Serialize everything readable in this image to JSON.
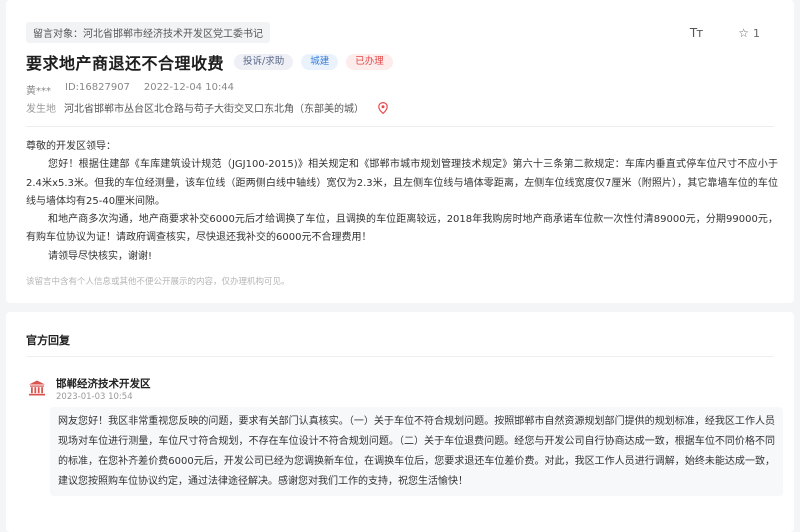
{
  "message": {
    "target_label": "留言对象：河北省邯郸市经济技术开发区党工委书记",
    "title": "要求地产商退还不合理收费",
    "badges": {
      "category": "投诉/求助",
      "department": "城建",
      "status": "已办理"
    },
    "tools": {
      "font_icon": "Tт",
      "likes": "1"
    },
    "author": "黄***",
    "id_label": "ID:16827907",
    "date": "2022-12-04 10:44",
    "location_label": "发生地",
    "location_value": "河北省邯郸市丛台区北仓路与苟子大街交叉口东北角（东部美的城）",
    "greeting": "尊敬的开发区领导：",
    "paragraphs": [
      "您好！根据住建部《车库建筑设计规范（JGJ100-2015)》相关规定和《邯郸市城市规划管理技术规定》第六十三条第二款规定：车库内垂直式停车位尺寸不应小于2.4米x5.3米。但我的车位经测量，该车位线（距两侧白线中轴线）宽仅为2.3米，且左侧车位线与墙体零距离，左侧车位线宽度仅7厘米（附照片），其它靠墙车位的车位线与墙体均有25-40厘米间隙。",
      "和地产商多次沟通，地产商要求补交6000元后才给调换了车位，且调换的车位距离较远，2018年我购房时地产商承诺车位款一次性付清89000元，分期99000元，有购车位协议为证！请政府调查核实，尽快退还我补交的6000元不合理费用！",
      "请领导尽快核实，谢谢!"
    ],
    "privacy_notice": "该留言中含有个人信息或其他不便公开展示的内容，仅办理机构可见。"
  },
  "reply": {
    "section_title": "官方回复",
    "org_name": "邯郸经济技术开发区",
    "date": "2023-01-03 10:54",
    "content": "网友您好！我区非常重视您反映的问题，要求有关部门认真核实。（一）关于车位不符合规划问题。按照邯郸市自然资源规划部门提供的规划标准，经我区工作人员现场对车位进行测量，车位尺寸符合规划，不存在车位设计不符合规划问题。（二）关于车位退费问题。经您与开发公司自行协商达成一致，根据车位不同价格不同的标准，在您补齐差价费6000元后，开发公司已经为您调换新车位，在调换车位后，您要求退还车位差价费。对此，我区工作人员进行调解，始终未能达成一致，建议您按照购车位协议约定，通过法律途径解决。感谢您对我们工作的支持，祝您生活愉快！"
  },
  "colors": {
    "status_red": "#e34a4a",
    "department_blue": "#3b7ed8",
    "pin_red": "#e84a4a",
    "org_icon_red": "#d9534f"
  },
  "icons": {
    "pin": "location-pin-icon",
    "star": "star-icon",
    "font": "font-size-icon",
    "org": "government-building-icon"
  }
}
